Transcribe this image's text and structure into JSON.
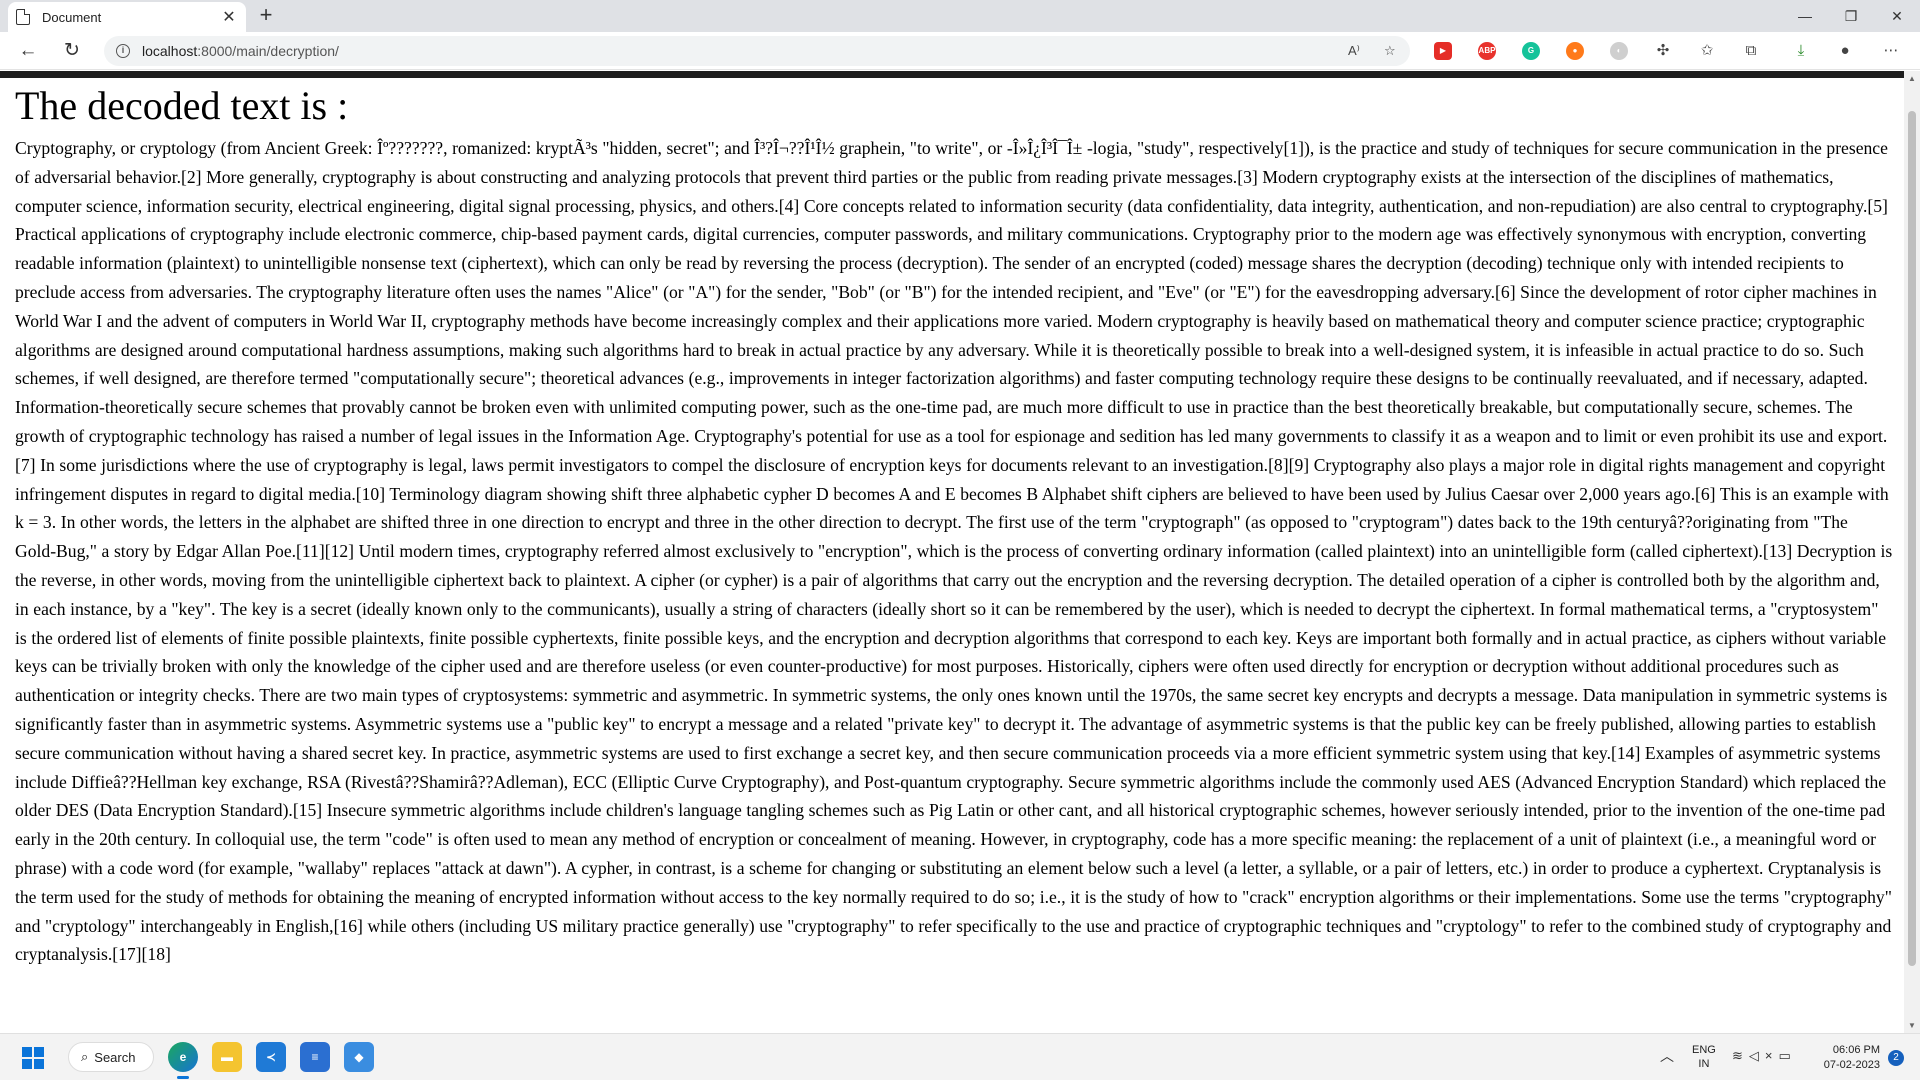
{
  "browser": {
    "tab_title": "Document",
    "tab_close": "✕",
    "new_tab": "+",
    "window_controls": {
      "minimize": "—",
      "restore": "❐",
      "close": "✕"
    },
    "nav": {
      "back": "←",
      "refresh": "↻"
    },
    "address": {
      "host": "localhost",
      "path": ":8000/main/decryption/"
    },
    "extensions": [
      {
        "name": "youtube-extension",
        "label": "▶",
        "color": "#e52d27"
      },
      {
        "name": "adblock-extension",
        "label": "ABP",
        "color": "#e8322c"
      },
      {
        "name": "grammarly-extension",
        "label": "G",
        "color": "#15c39a"
      },
      {
        "name": "cookie-extension",
        "label": "●",
        "color": "#ff7a1a"
      },
      {
        "name": "moon-extension",
        "label": "◐",
        "color": "#cfcfcf"
      }
    ]
  },
  "page": {
    "heading": "The decoded text is :",
    "body": "Cryptography, or cryptology (from Ancient Greek: Îº???????, romanized: kryptÃ³s \"hidden, secret\"; and Î³?Î¬??Î¹Î½ graphein, \"to write\", or -Î»Î¿Î³Î¯Î± -logia, \"study\", respectively[1]), is the practice and study of techniques for secure communication in the presence of adversarial behavior.[2] More generally, cryptography is about constructing and analyzing protocols that prevent third parties or the public from reading private messages.[3] Modern cryptography exists at the intersection of the disciplines of mathematics, computer science, information security, electrical engineering, digital signal processing, physics, and others.[4] Core concepts related to information security (data confidentiality, data integrity, authentication, and non-repudiation) are also central to cryptography.[5] Practical applications of cryptography include electronic commerce, chip-based payment cards, digital currencies, computer passwords, and military communications. Cryptography prior to the modern age was effectively synonymous with encryption, converting readable information (plaintext) to unintelligible nonsense text (ciphertext), which can only be read by reversing the process (decryption). The sender of an encrypted (coded) message shares the decryption (decoding) technique only with intended recipients to preclude access from adversaries. The cryptography literature often uses the names \"Alice\" (or \"A\") for the sender, \"Bob\" (or \"B\") for the intended recipient, and \"Eve\" (or \"E\") for the eavesdropping adversary.[6] Since the development of rotor cipher machines in World War I and the advent of computers in World War II, cryptography methods have become increasingly complex and their applications more varied. Modern cryptography is heavily based on mathematical theory and computer science practice; cryptographic algorithms are designed around computational hardness assumptions, making such algorithms hard to break in actual practice by any adversary. While it is theoretically possible to break into a well-designed system, it is infeasible in actual practice to do so. Such schemes, if well designed, are therefore termed \"computationally secure\"; theoretical advances (e.g., improvements in integer factorization algorithms) and faster computing technology require these designs to be continually reevaluated, and if necessary, adapted. Information-theoretically secure schemes that provably cannot be broken even with unlimited computing power, such as the one-time pad, are much more difficult to use in practice than the best theoretically breakable, but computationally secure, schemes. The growth of cryptographic technology has raised a number of legal issues in the Information Age. Cryptography's potential for use as a tool for espionage and sedition has led many governments to classify it as a weapon and to limit or even prohibit its use and export.[7] In some jurisdictions where the use of cryptography is legal, laws permit investigators to compel the disclosure of encryption keys for documents relevant to an investigation.[8][9] Cryptography also plays a major role in digital rights management and copyright infringement disputes in regard to digital media.[10] Terminology diagram showing shift three alphabetic cypher D becomes A and E becomes B Alphabet shift ciphers are believed to have been used by Julius Caesar over 2,000 years ago.[6] This is an example with k = 3. In other words, the letters in the alphabet are shifted three in one direction to encrypt and three in the other direction to decrypt. The first use of the term \"cryptograph\" (as opposed to \"cryptogram\") dates back to the 19th centuryâ??originating from \"The Gold-Bug,\" a story by Edgar Allan Poe.[11][12] Until modern times, cryptography referred almost exclusively to \"encryption\", which is the process of converting ordinary information (called plaintext) into an unintelligible form (called ciphertext).[13] Decryption is the reverse, in other words, moving from the unintelligible ciphertext back to plaintext. A cipher (or cypher) is a pair of algorithms that carry out the encryption and the reversing decryption. The detailed operation of a cipher is controlled both by the algorithm and, in each instance, by a \"key\". The key is a secret (ideally known only to the communicants), usually a string of characters (ideally short so it can be remembered by the user), which is needed to decrypt the ciphertext. In formal mathematical terms, a \"cryptosystem\" is the ordered list of elements of finite possible plaintexts, finite possible cyphertexts, finite possible keys, and the encryption and decryption algorithms that correspond to each key. Keys are important both formally and in actual practice, as ciphers without variable keys can be trivially broken with only the knowledge of the cipher used and are therefore useless (or even counter-productive) for most purposes. Historically, ciphers were often used directly for encryption or decryption without additional procedures such as authentication or integrity checks. There are two main types of cryptosystems: symmetric and asymmetric. In symmetric systems, the only ones known until the 1970s, the same secret key encrypts and decrypts a message. Data manipulation in symmetric systems is significantly faster than in asymmetric systems. Asymmetric systems use a \"public key\" to encrypt a message and a related \"private key\" to decrypt it. The advantage of asymmetric systems is that the public key can be freely published, allowing parties to establish secure communication without having a shared secret key. In practice, asymmetric systems are used to first exchange a secret key, and then secure communication proceeds via a more efficient symmetric system using that key.[14] Examples of asymmetric systems include Diffieâ??Hellman key exchange, RSA (Rivestâ??Shamirâ??Adleman), ECC (Elliptic Curve Cryptography), and Post-quantum cryptography. Secure symmetric algorithms include the commonly used AES (Advanced Encryption Standard) which replaced the older DES (Data Encryption Standard).[15] Insecure symmetric algorithms include children's language tangling schemes such as Pig Latin or other cant, and all historical cryptographic schemes, however seriously intended, prior to the invention of the one-time pad early in the 20th century. In colloquial use, the term \"code\" is often used to mean any method of encryption or concealment of meaning. However, in cryptography, code has a more specific meaning: the replacement of a unit of plaintext (i.e., a meaningful word or phrase) with a code word (for example, \"wallaby\" replaces \"attack at dawn\"). A cypher, in contrast, is a scheme for changing or substituting an element below such a level (a letter, a syllable, or a pair of letters, etc.) in order to produce a cyphertext. Cryptanalysis is the term used for the study of methods for obtaining the meaning of encrypted information without access to the key normally required to do so; i.e., it is the study of how to \"crack\" encryption algorithms or their implementations. Some use the terms \"cryptography\" and \"cryptology\" interchangeably in English,[16] while others (including US military practice generally) use \"cryptography\" to refer specifically to the use and practice of cryptographic techniques and \"cryptology\" to refer to the combined study of cryptography and cryptanalysis.[17][18]"
  },
  "taskbar": {
    "search_label": "Search",
    "language": {
      "line1": "ENG",
      "line2": "IN"
    },
    "clock": {
      "time": "06:06 PM",
      "date": "07-02-2023"
    },
    "notification_count": "2"
  }
}
